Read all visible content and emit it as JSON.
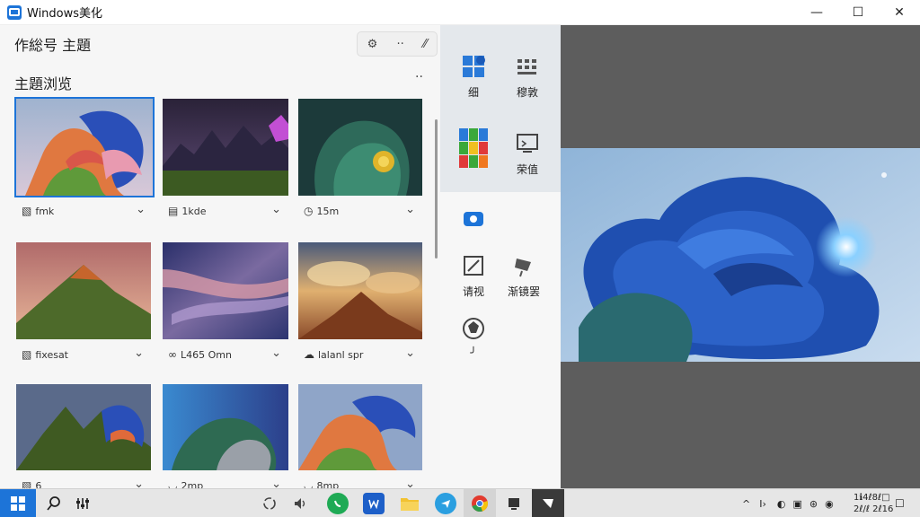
{
  "window": {
    "title": "Windows美化",
    "controls": {
      "minimize": "—",
      "maximize": "☐",
      "close": "✕"
    }
  },
  "left_panel": {
    "title": "作総号 主題",
    "header_tools": [
      "⚙",
      "··",
      "⁄⁄"
    ],
    "section_title": "主題浏览",
    "section_more": "··",
    "cards": [
      {
        "caption": "fmk",
        "icon": "photo-icon",
        "icon_glyph": "▧",
        "selected": true
      },
      {
        "caption": "1kde",
        "icon": "photo-icon",
        "icon_glyph": "▤",
        "selected": false
      },
      {
        "caption": "15m",
        "icon": "clock-icon",
        "icon_glyph": "◷",
        "selected": false
      },
      {
        "caption": "fixesat",
        "icon": "photo-icon",
        "icon_glyph": "▧",
        "selected": false
      },
      {
        "caption": "L465 Omn",
        "icon": "link-icon",
        "icon_glyph": "∞",
        "selected": false
      },
      {
        "caption": "lalanl spr",
        "icon": "cloud-icon",
        "icon_glyph": "☁",
        "selected": false
      },
      {
        "caption": "6",
        "icon": "photo-icon",
        "icon_glyph": "▧",
        "selected": false
      },
      {
        "caption": "2mp",
        "icon": "cup-icon",
        "icon_glyph": "◡",
        "selected": false
      },
      {
        "caption": "8mp",
        "icon": "cup-icon",
        "icon_glyph": "◡",
        "selected": false
      }
    ]
  },
  "mid_panel": {
    "items": [
      {
        "label": "细",
        "icon": "color-grid-icon"
      },
      {
        "label": "穆敦",
        "icon": "keyboard-icon"
      },
      {
        "label": "",
        "icon": "color-windows-icon"
      },
      {
        "label": "荣值",
        "icon": "screen-icon"
      },
      {
        "label": "",
        "icon": "camera-icon"
      },
      {
        "label": "请视",
        "icon": "edit-icon"
      },
      {
        "label": "渐镜罢",
        "icon": "brush-icon"
      },
      {
        "label": "╯",
        "icon": "ball-icon"
      }
    ]
  },
  "taskbar": {
    "apps": [
      "search-icon",
      "settings-icon",
      "sync-icon",
      "volume-icon",
      "whatsapp-icon",
      "word-icon",
      "folder-icon",
      "telegram-icon",
      "chrome-icon",
      "app-icon",
      "active-app-icon"
    ],
    "tray": [
      "^",
      "I›",
      "◐",
      "▣",
      "⊛",
      "◉"
    ],
    "clock_time": "1ℹ4ℓ8ℓ□",
    "clock_date": "2ℓ/ℓ 2ℓ16",
    "notification": "☐"
  },
  "colors": {
    "accent": "#1d74d8",
    "preview_bg": "#5d5d5d"
  }
}
